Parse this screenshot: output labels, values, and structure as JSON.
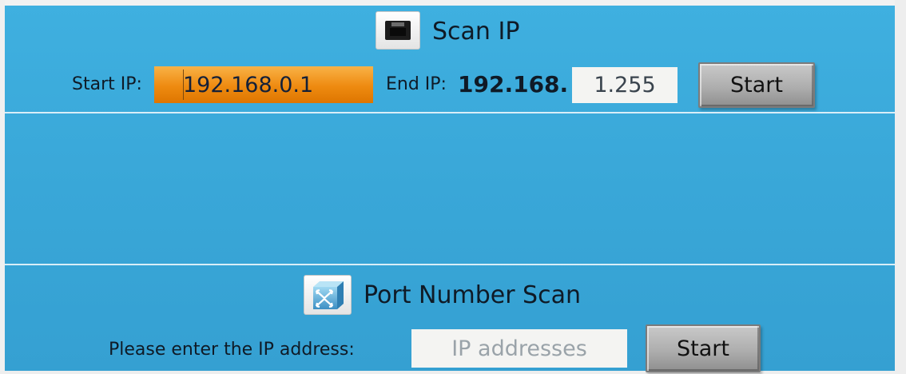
{
  "scan_ip": {
    "title": "Scan IP",
    "icon": "ethernet-port-icon",
    "start_label": "Start IP:",
    "start_value": "192.168.0.1",
    "end_label": "End IP:",
    "end_prefix": "192.168.",
    "end_value": "1.255",
    "start_button": "Start"
  },
  "port_scan": {
    "title": "Port Number Scan",
    "icon": "network-switch-icon",
    "ip_label": "Please enter the IP address:",
    "ip_placeholder": "IP addresses",
    "start_button": "Start"
  },
  "colors": {
    "background": "#3aa8d8",
    "active_field": "#ee8a10",
    "button": "#aeaeae"
  }
}
